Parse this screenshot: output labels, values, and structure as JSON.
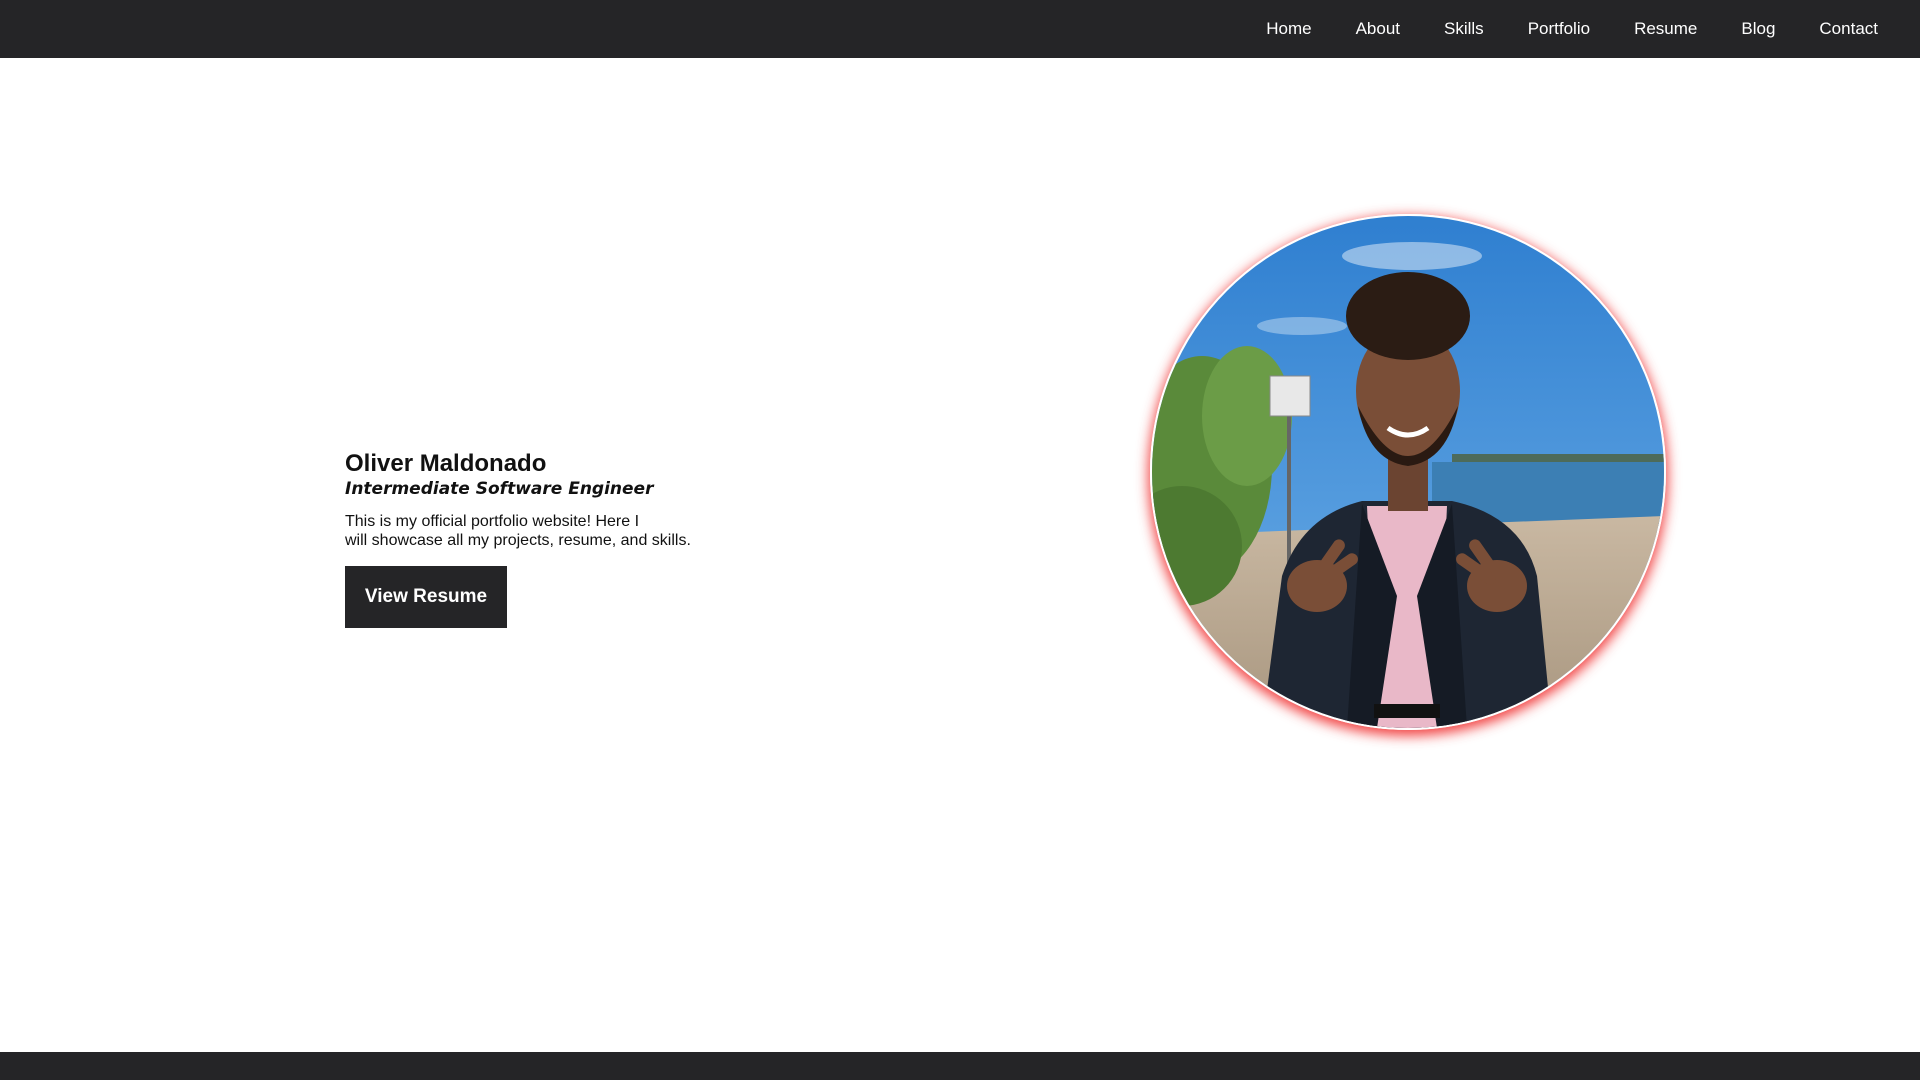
{
  "nav": {
    "items": [
      "Home",
      "About",
      "Skills",
      "Portfolio",
      "Resume",
      "Blog",
      "Contact"
    ]
  },
  "hero": {
    "name": "Oliver Maldonado",
    "title": "Intermediate Software Engineer",
    "description_line1": "This is my official portfolio website! Here I",
    "description_line2": "will showcase all my projects, resume, and skills.",
    "button_label": "View Resume"
  },
  "colors": {
    "nav_background": "#252527",
    "button_background": "#252527",
    "photo_glow": "#f02828",
    "page_background": "#ffffff"
  }
}
